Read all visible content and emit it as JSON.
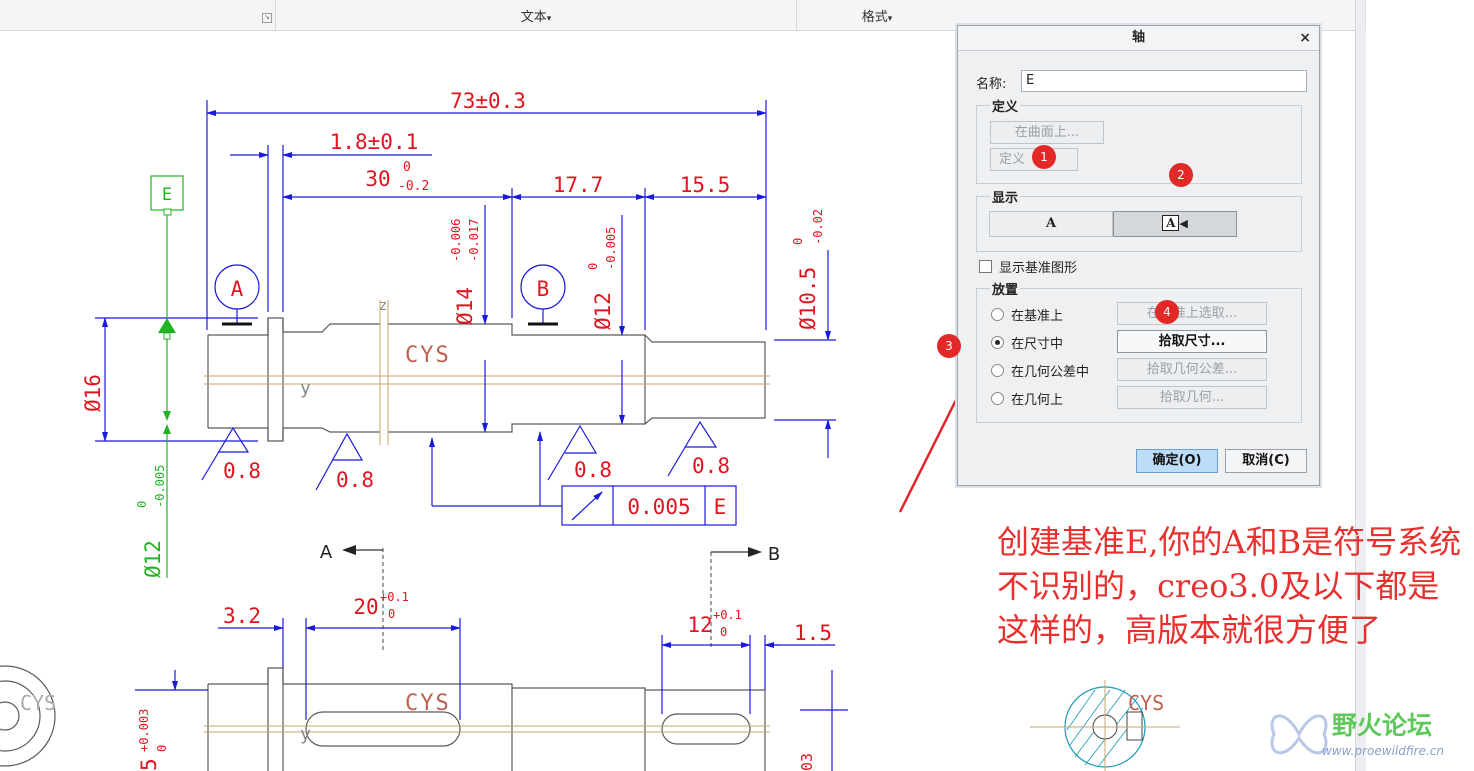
{
  "ribbon": {
    "text_group": "文本",
    "format_group": "格式",
    "dropdown_mark": "▾"
  },
  "dialog": {
    "title": "轴",
    "close_glyph": "×",
    "name_label": "名称:",
    "name_value": "E",
    "define_section": "定义",
    "on_surface_button": "在曲面上...",
    "define_button": "定义",
    "display_section": "显示",
    "display_option_a": "A",
    "display_option_a_flag": "A",
    "show_datum_checkbox": "显示基准图形",
    "show_datum_checked": false,
    "placement_section": "放置",
    "placement_options": [
      {
        "label": "在基准上",
        "button": "在基准上选取...",
        "selected": false,
        "enabled": false
      },
      {
        "label": "在尺寸中",
        "button": "拾取尺寸...",
        "selected": true,
        "enabled": true
      },
      {
        "label": "在几何公差中",
        "button": "拾取几何公差...",
        "selected": false,
        "enabled": false
      },
      {
        "label": "在几何上",
        "button": "拾取几何...",
        "selected": false,
        "enabled": false
      }
    ],
    "ok_button": "确定(O)",
    "cancel_button": "取消(C)"
  },
  "badges": [
    "1",
    "2",
    "3",
    "4"
  ],
  "annotation_note": "创建基准E,你的A和B是符号系统不识别的，creo3.0及以下都是这样的，高版本就很方便了",
  "drawing": {
    "dim_overall": "73±0.3",
    "dim_flange": "1.8±0.1",
    "dim_30": "30",
    "dim_30_upper": "0",
    "dim_30_lower": "-0.2",
    "dim_17_7": "17.7",
    "dim_15_5": "15.5",
    "dia_14": "Ø14",
    "dia_14_tol_upper": "-0.006",
    "dia_14_tol_lower": "-0.017",
    "dia_12": "Ø12",
    "dia_12_tol_upper": "0",
    "dia_12_tol_lower": "-0.005",
    "dia_10_5": "Ø10.5",
    "dia_10_5_tol_upper": "0",
    "dia_10_5_tol_lower": "-0.02",
    "dia_16": "Ø16",
    "dia_12_green": "Ø12",
    "dia_12_green_tol_upper": "0",
    "dia_12_green_tol_lower": "-0.005",
    "datum_a": "A",
    "datum_b": "B",
    "datum_e": "E",
    "cys": "CYS",
    "axis_y": "y",
    "axis_z": "z",
    "roughness": [
      "0.8",
      "0.8",
      "0.8",
      "0.8"
    ],
    "runout_tol": "0.005",
    "runout_ref": "E",
    "section_a": "A",
    "section_b": "B",
    "dim_3_2": "3.2",
    "dim_20": "20",
    "dim_20_upper": "+0.1",
    "dim_20_lower": "0",
    "dim_12": "12",
    "dim_12_upper": "+0.1",
    "dim_12_lower": "0",
    "dim_1_5": "1.5",
    "dim_5": "5",
    "dim_5_upper": "+0.003",
    "dim_5_lower": "0",
    "dim_03_partial": "03"
  },
  "watermark": {
    "title": "野火论坛",
    "url": "www.proewildfire.cn"
  },
  "colors": {
    "dimension_red": "#e0141e",
    "dimension_blue": "#1a1adb",
    "datum_green": "#22b322",
    "geometry_gray": "#5a5a5a",
    "annotation_red": "#e8312f",
    "badge_red": "#e32828",
    "ok_blue": "#bcdcf7"
  }
}
